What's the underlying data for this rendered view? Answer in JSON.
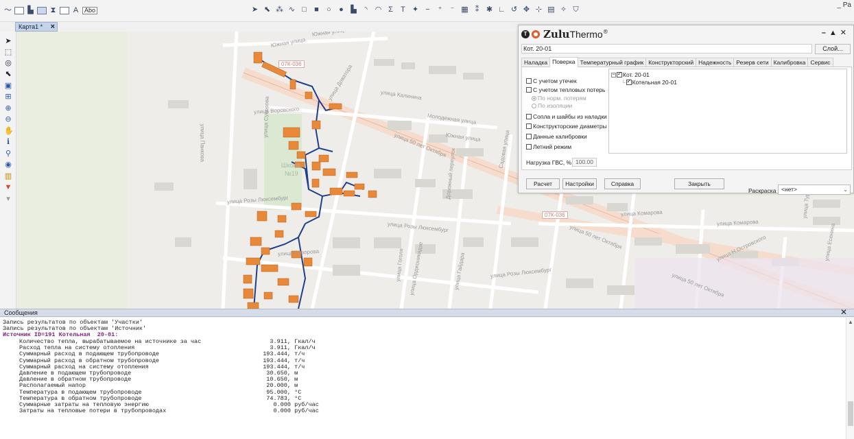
{
  "toolbar": {
    "text_tool_label": "Abo",
    "right_clip": "Pa"
  },
  "doc_tab": {
    "label": "Карта1 *"
  },
  "map": {
    "labels": {
      "st_zhovn": "Южная улица",
      "st_kalinina": "улица Калинина",
      "st_dovatora": "улица Доватора",
      "st_vorovskogo": "улица Воровского",
      "st_molodezh": "Молодежная улица",
      "st_yuzhnaya": "Южная улица",
      "st_pankova": "улица Панкова",
      "st_suvorova_v": "улица Суворова",
      "st_50let_1": "улица 50 лет Октября",
      "st_50let_2": "улица 50 лет Октября",
      "st_50let_3": "улица 50 лет Октября",
      "st_sadovaya": "Садовая улица",
      "school": "Школа",
      "school_num": "№19",
      "st_luxemburg_1": "улица Розы Люксембург",
      "st_luxemburg_2": "улица Розы Люксембург",
      "st_luxemburg_3": "улица Розы Люксембург",
      "st_suvorova": "улица Суворова",
      "st_dorozhny": "Дорожный переулок",
      "st_gogolya": "улица Гоголя",
      "st_ordzhonikidze": "улица Орджоникидзе",
      "st_gaidara": "улица Гайдара",
      "st_komarova_1": "улица Комарова",
      "st_komarova_2": "улица Комарова",
      "st_ostrovskogo": "улица Н.Островского",
      "st_turgeneva": "улица Тургенева",
      "st_eseniya": "улица Есенина",
      "road_tag_1": "07К-036",
      "road_tag_2": "07К-036",
      "st_zhovn2": "Южная улица"
    },
    "colors": {
      "background": "#eeedea",
      "road_main": "#f6d8c8",
      "building": "#d8d6d0",
      "pipe": "#1f3f8a",
      "consumer": "#e8893a"
    }
  },
  "dialog": {
    "title_bold": "Zulu",
    "title_rest": "Thermo",
    "title_reg": "®",
    "object_value": "Кот. 20-01",
    "layer_button": "Слой...",
    "tabs": [
      "Наладка",
      "Поверка",
      "Температурный график",
      "Конструкторский",
      "Надежность",
      "Резерв сети",
      "Калибровка",
      "Сервис"
    ],
    "options": {
      "leaks": "С учетом утечек",
      "heat_losses": "С учетом тепловых потерь",
      "norm_losses": "По норм. потерям",
      "insulation": "По изоляции",
      "nozzles": "Сопла и шайбы из наладки",
      "diameters": "Конструкторские диаметры",
      "calibration": "Данные калибровки",
      "summer": "Летний режим"
    },
    "gvs_label": "Нагрузка ГВС, %",
    "gvs_value": "100.00",
    "tree": {
      "root": "Кот. 20-01",
      "child": "Котельная  20-01"
    },
    "paint_label": "Раскраска",
    "paint_value": "<нет>",
    "buttons": {
      "calc": "Расчет",
      "settings": "Настройки",
      "help": "Справка",
      "close": "Закрыть"
    }
  },
  "messages": {
    "header": "Сообщения",
    "lines": {
      "l1": "Запись результатов по объектам 'Участки'",
      "l2": "Запись результатов по объектам 'Источник'",
      "l3": "Источник ID=191 Котельная  20-01:"
    },
    "results": [
      {
        "name": "Количество тепла, вырабатываемое на источнике за час",
        "value": "3.911,",
        "unit": "Гкал/ч"
      },
      {
        "name": "Расход тепла на систему отопления",
        "value": "3.911,",
        "unit": "Гкал/ч"
      },
      {
        "name": "Суммарный расход в подающем трубопроводе",
        "value": "193.444,",
        "unit": "т/ч"
      },
      {
        "name": "Суммарный расход в обратном трубопроводе",
        "value": "193.444,",
        "unit": "т/ч"
      },
      {
        "name": "Суммарный расход на систему отопления",
        "value": "193.444,",
        "unit": "т/ч"
      },
      {
        "name": "Давление в подающем трубопроводе",
        "value": "30.650,",
        "unit": "м"
      },
      {
        "name": "Давление в обратном трубопроводе",
        "value": "10.650,",
        "unit": "м"
      },
      {
        "name": "Располагаемый напор",
        "value": "20.000,",
        "unit": "м"
      },
      {
        "name": "Температура в подающем трубопроводе",
        "value": "95.000,",
        "unit": "°C"
      },
      {
        "name": "Температура в обратном трубопроводе",
        "value": "74.783,",
        "unit": "°C"
      },
      {
        "name": "Суммарные затраты на тепловую энергию",
        "value": "0.000",
        "unit": "руб/час"
      },
      {
        "name": "Затраты на тепловые потери в трубопроводах",
        "value": "0.000",
        "unit": "руб/час"
      }
    ]
  }
}
